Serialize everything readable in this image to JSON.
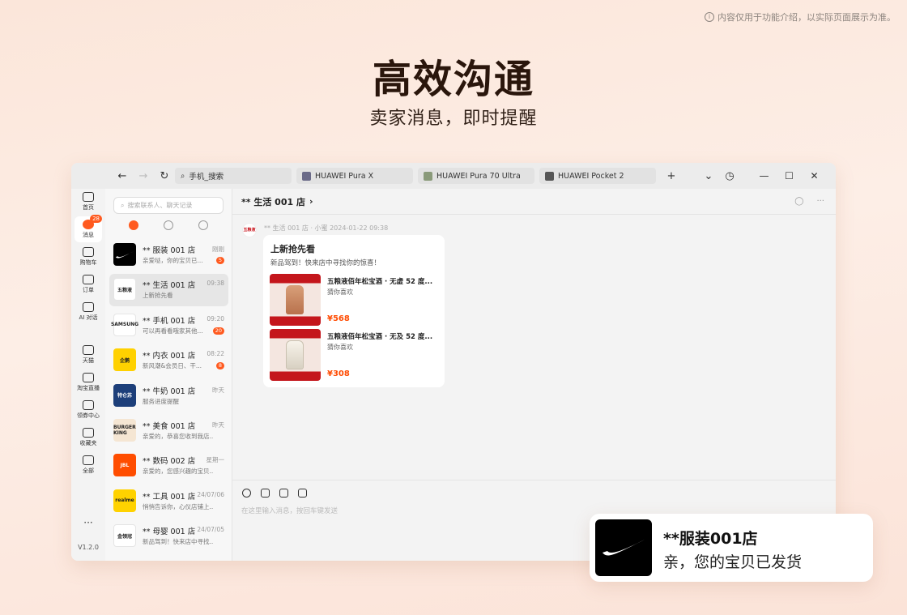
{
  "disclaimer": "内容仅用于功能介绍，以实际页面展示为准。",
  "headline": "高效沟通",
  "subhead": "卖家消息，即时提醒",
  "browser": {
    "search_value": "手机_搜索",
    "tabs": [
      "HUAWEI Pura X",
      "HUAWEI Pura 70 Ultra",
      "HUAWEI Pocket 2"
    ],
    "new_tab": "+"
  },
  "rail": {
    "items": [
      "首页",
      "消息",
      "购物车",
      "订单",
      "AI 对话",
      "天猫",
      "淘宝直播",
      "领券中心",
      "收藏夹",
      "全部"
    ],
    "message_badge": "28",
    "version": "V1.2.0",
    "more": "···"
  },
  "convlist": {
    "search_placeholder": "搜索联系人、聊天记录",
    "conversations": [
      {
        "name": "** 服装 001 店",
        "time": "刚刚",
        "preview": "亲爱哒，你的宝贝已...",
        "unread": "5",
        "logo": "swoosh",
        "logo_bg": "#000000"
      },
      {
        "name": "** 生活 001 店",
        "time": "09:38",
        "preview": "上新抢先看",
        "unread": "",
        "logo": "五粮液",
        "logo_bg": "#ffffff"
      },
      {
        "name": "** 手机 001 店",
        "time": "09:20",
        "preview": "可以再看看哦家其他...",
        "unread": "20",
        "logo": "SAMSUNG",
        "logo_bg": "#ffffff"
      },
      {
        "name": "** 内衣 001 店",
        "time": "08:22",
        "preview": "新风潮&会员日、干...",
        "unread": "8",
        "logo": "企鹅",
        "logo_bg": "#ffd100"
      },
      {
        "name": "** 牛奶 001 店",
        "time": "昨天",
        "preview": "服务进度提醒",
        "unread": "",
        "logo": "特仑苏",
        "logo_bg": "#1d3f7a"
      },
      {
        "name": "** 美食 001 店",
        "time": "昨天",
        "preview": "亲爱的，恭喜您收到我店...",
        "unread": "",
        "logo": "BURGER KING",
        "logo_bg": "#f5e6d3"
      },
      {
        "name": "** 数码 002 店",
        "time": "星期一",
        "preview": "亲爱的，您感兴趣的宝贝...",
        "unread": "",
        "logo": "JBL",
        "logo_bg": "#ff4d00"
      },
      {
        "name": "** 工具 001 店",
        "time": "24/07/06",
        "preview": "悄悄告诉你，心仪店铺上...",
        "unread": "",
        "logo": "realme",
        "logo_bg": "#ffd200"
      },
      {
        "name": "** 母婴 001 店",
        "time": "24/07/05",
        "preview": "新品驾到！快来店中寻找...",
        "unread": "",
        "logo": "金领冠",
        "logo_bg": "#ffffff"
      }
    ]
  },
  "chat": {
    "title": "** 生活 001 店",
    "sender_meta": "** 生活 001 店 · 小蜜  2024-01-22 09:38",
    "card": {
      "title": "上新抢先看",
      "subtitle": "新品驾到！快来店中寻找你的惊喜！",
      "products": [
        {
          "name": "五粮液佰年松宝酒 · 无虚 52 度...",
          "tag": "猜你喜欢",
          "price": "¥568"
        },
        {
          "name": "五粮液佰年松宝酒 · 无及 52 度...",
          "tag": "猜你喜欢",
          "price": "¥308"
        }
      ]
    },
    "input_placeholder": "在这里输入消息，按回车键发送"
  },
  "toast": {
    "title": "**服装001店",
    "body": "亲，您的宝贝已发货"
  },
  "colors": {
    "accent": "#ff5a1f",
    "price": "#ff4a00",
    "headline": "#2a160c"
  }
}
